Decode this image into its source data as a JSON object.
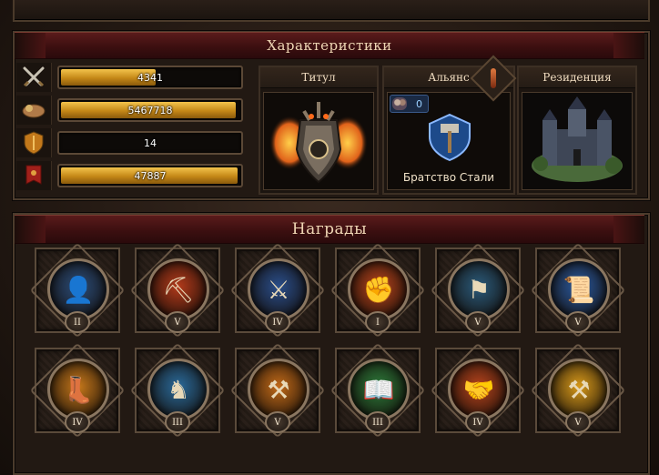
{
  "characteristics": {
    "title": "Характеристики",
    "stats": [
      {
        "icon": "crossed-swords-icon",
        "value": "4341",
        "fill": 0.52
      },
      {
        "icon": "coin-bag-icon",
        "value": "5467718",
        "fill": 0.97
      },
      {
        "icon": "shield-icon",
        "value": "14",
        "fill": 0.0
      },
      {
        "icon": "war-banner-icon",
        "value": "47887",
        "fill": 0.98
      }
    ],
    "cards": {
      "title_label": "Титул",
      "alliance_label": "Альянс",
      "alliance_count": "0",
      "alliance_name": "Братство Стали",
      "residence_label": "Резиденция"
    }
  },
  "awards": {
    "title": "Награды",
    "items": [
      {
        "icon": "hooded-figure-icon",
        "rank": "II",
        "color": "#2b4d7a"
      },
      {
        "icon": "catapult-icon",
        "rank": "V",
        "color": "#b33a1a"
      },
      {
        "icon": "crossed-banner-icon",
        "rank": "IV",
        "color": "#2a4e8a"
      },
      {
        "icon": "whip-icon",
        "rank": "I",
        "color": "#b8441c"
      },
      {
        "icon": "fortified-flag-icon",
        "rank": "V",
        "color": "#2a5a7a"
      },
      {
        "icon": "scroll-icon",
        "rank": "V",
        "color": "#2a5aa0"
      },
      {
        "icon": "boot-icon",
        "rank": "IV",
        "color": "#c7781a"
      },
      {
        "icon": "horse-head-icon",
        "rank": "III",
        "color": "#2a6a9a"
      },
      {
        "icon": "hammers-icon",
        "rank": "V",
        "color": "#c26a18"
      },
      {
        "icon": "spellbook-icon",
        "rank": "III",
        "color": "#2d7a3a"
      },
      {
        "icon": "handshake-icon",
        "rank": "IV",
        "color": "#b8441c"
      },
      {
        "icon": "smith-silhouette-icon",
        "rank": "V",
        "color": "#d99a1a"
      }
    ]
  }
}
